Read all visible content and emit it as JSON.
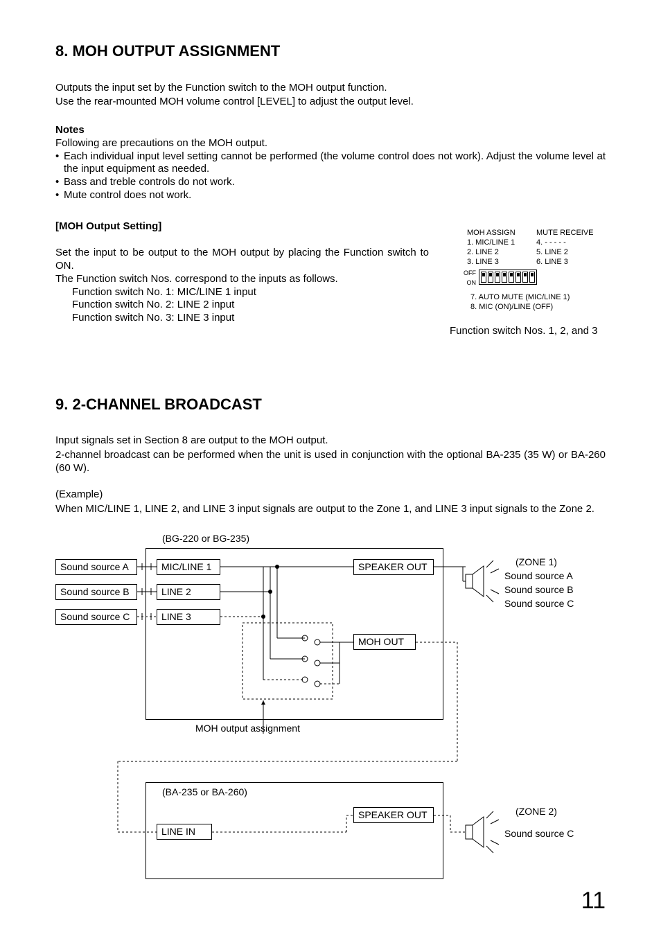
{
  "section8": {
    "heading": "8. MOH OUTPUT ASSIGNMENT",
    "p1": "Outputs the input set by the Function switch to the MOH output function.",
    "p2": "Use the rear-mounted MOH volume control [LEVEL] to adjust the output level.",
    "notes_title": "Notes",
    "notes_intro": "Following are precautions on the MOH output.",
    "bullets": [
      "Each individual input level setting cannot be performed (the volume control does not work). Adjust the volume level at the input equipment as needed.",
      "Bass and treble controls do not work.",
      "Mute control does not work."
    ],
    "sub_heading": "[MOH Output Setting]",
    "moh_p1": "Set the input to be output to the MOH output by placing the Function switch to ON.",
    "moh_p2": "The Function switch Nos. correspond to the inputs as follows.",
    "moh_lines": [
      "Function switch No. 1: MIC/LINE 1 input",
      "Function switch No. 2: LINE 2 input",
      "Function switch No. 3: LINE 3 input"
    ],
    "dip_caption": "Function switch Nos. 1, 2, and 3",
    "dip": {
      "header_left": "MOH ASSIGN",
      "header_right": "MUTE RECEIVE",
      "left": [
        "1. MIC/LINE 1",
        "2. LINE 2",
        "3. LINE 3"
      ],
      "right": [
        "4. - - - - -",
        "5. LINE 2",
        "6. LINE 3"
      ],
      "off": "OFF",
      "on": "ON",
      "bottom": [
        "7. AUTO MUTE (MIC/LINE 1)",
        "8. MIC (ON)/LINE (OFF)"
      ]
    }
  },
  "section9": {
    "heading": "9. 2-CHANNEL BROADCAST",
    "p1": "Input signals set in Section 8 are output to the MOH output.",
    "p2": "2-channel broadcast can be performed when the unit is used in conjunction with the optional BA-235 (35 W) or BA-260 (60 W).",
    "example_label": "(Example)",
    "example_text": "When MIC/LINE 1, LINE 2, and LINE 3 input signals are output to the Zone 1, and LINE 3 input signals to the Zone 2.",
    "diagram": {
      "bg_label": "(BG-220 or BG-235)",
      "ba_label": "(BA-235 or BA-260)",
      "sources": [
        "Sound source A",
        "Sound source B",
        "Sound source C"
      ],
      "inputs": [
        "MIC/LINE 1",
        "LINE 2",
        "LINE 3"
      ],
      "speaker_out": "SPEAKER OUT",
      "moh_out": "MOH OUT",
      "moh_assignment": "MOH output assignment",
      "line_in": "LINE IN",
      "zone1": "(ZONE 1)",
      "zone1_sources": [
        "Sound source A",
        "Sound source B",
        "Sound source C"
      ],
      "zone2": "(ZONE 2)",
      "zone2_sources": [
        "Sound source C"
      ]
    }
  },
  "page_number": "11"
}
